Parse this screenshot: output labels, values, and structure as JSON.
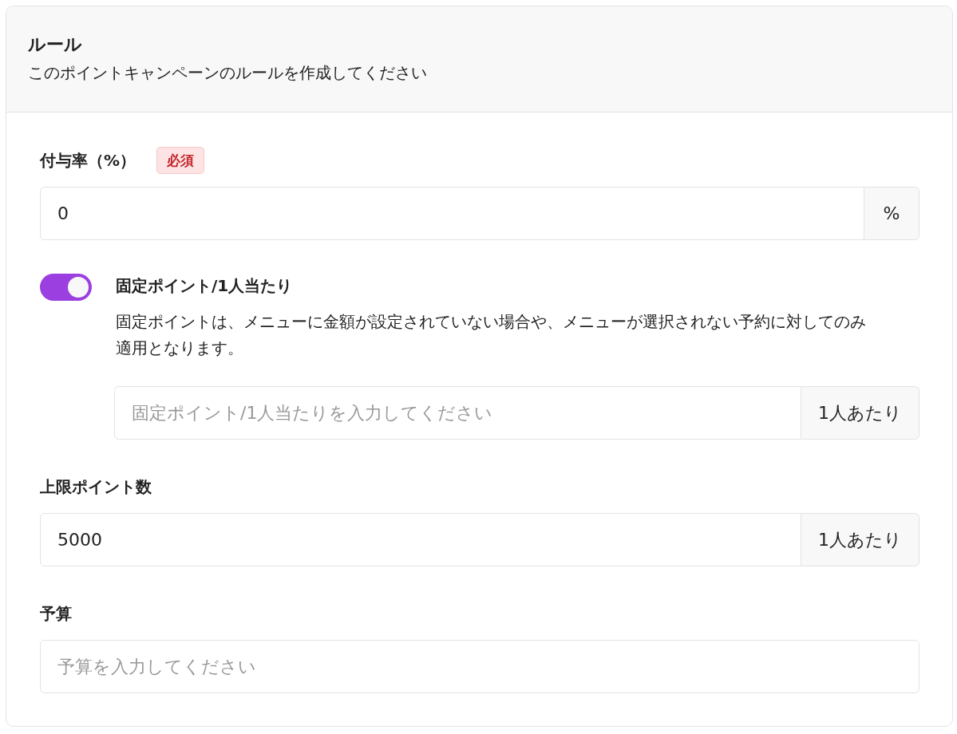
{
  "header": {
    "title": "ルール",
    "subtitle": "このポイントキャンペーンのルールを作成してください"
  },
  "fields": [
    {
      "kind": "input",
      "label": "付与率（%）",
      "badge": "必須",
      "value": "0",
      "addon": "%"
    },
    {
      "kind": "toggle",
      "label": "固定ポイント/1人当たり",
      "on": true,
      "description": "固定ポイントは、メニューに金額が設定されていない場合や、メニューが選択されない予約に対してのみ適用となります。",
      "input": {
        "placeholder": "固定ポイント/1人当たりを入力してください",
        "addon": "1人あたり"
      }
    },
    {
      "kind": "input",
      "label": "上限ポイント数",
      "value": "5000",
      "addon": "1人あたり"
    },
    {
      "kind": "input",
      "label": "予算",
      "placeholder": "予算を入力してください"
    }
  ]
}
